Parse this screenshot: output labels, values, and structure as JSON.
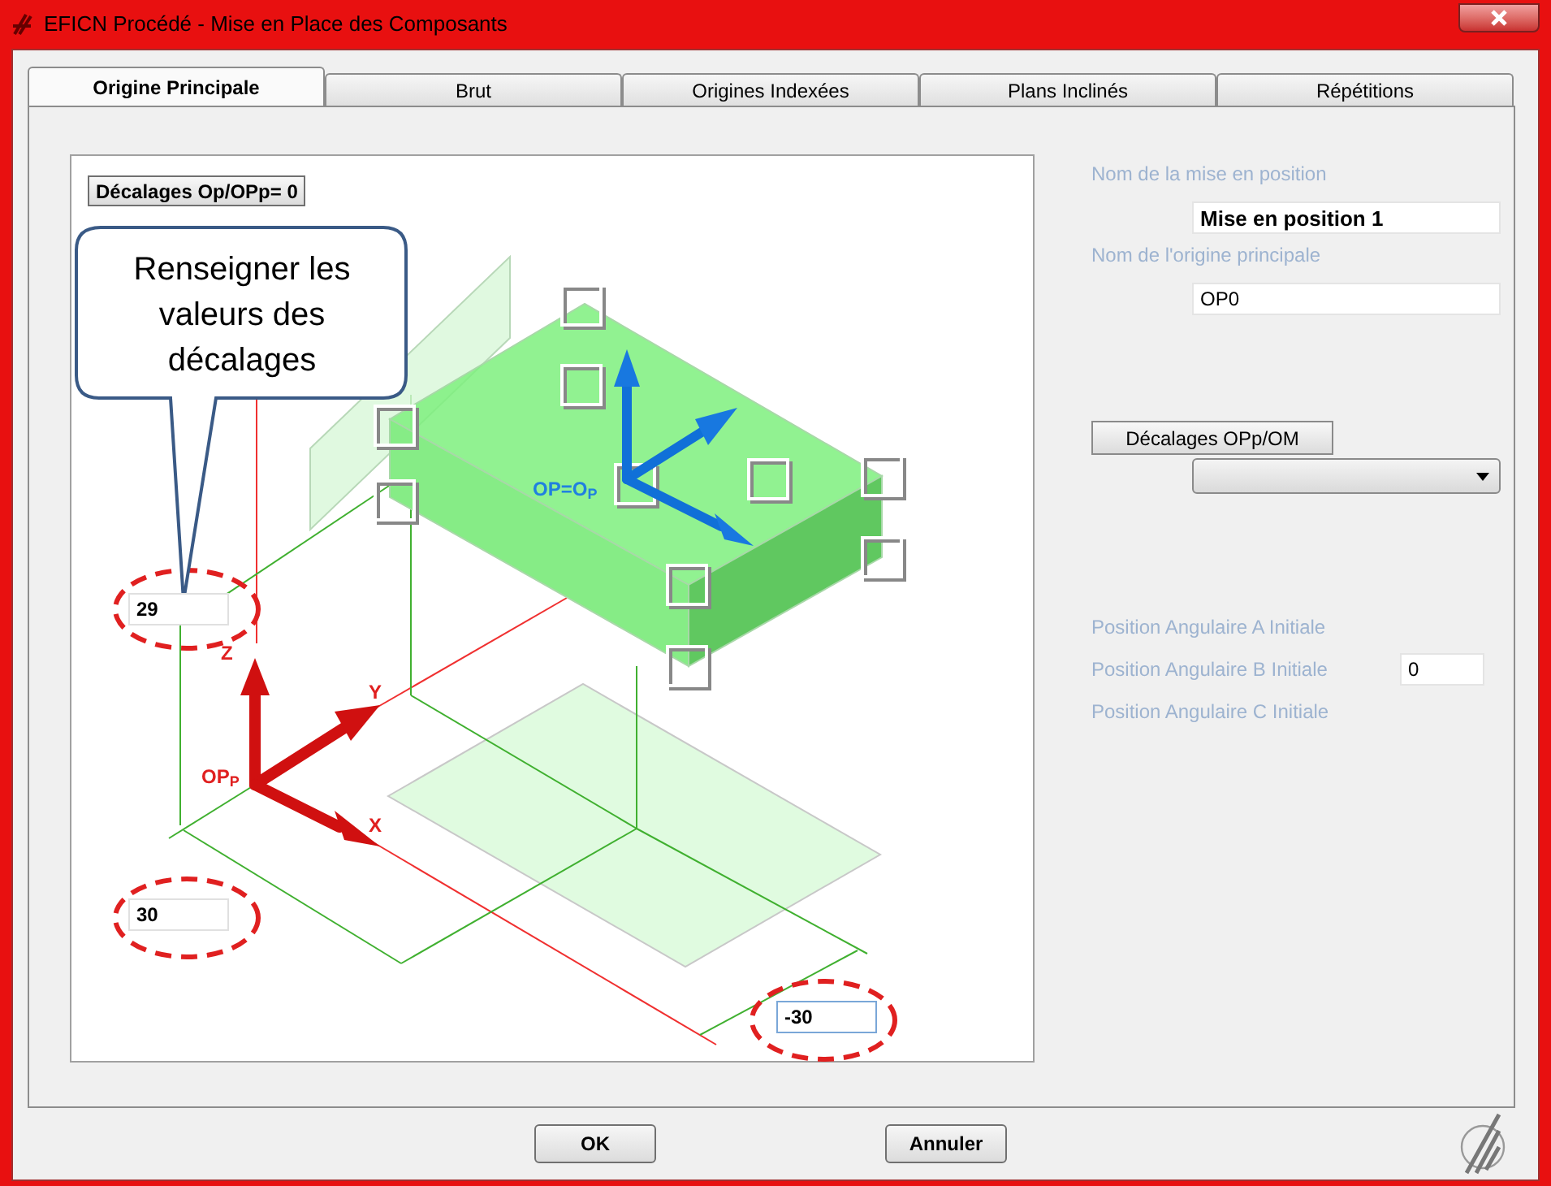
{
  "window": {
    "title": "EFICN Procédé - Mise en Place des Composants"
  },
  "tabs": [
    {
      "label": "Origine Principale",
      "selected": true
    },
    {
      "label": "Brut",
      "selected": false
    },
    {
      "label": "Origines Indexées",
      "selected": false
    },
    {
      "label": "Plans Inclinés",
      "selected": false
    },
    {
      "label": "Répétitions",
      "selected": false
    }
  ],
  "diagram": {
    "offset_button": "Décalages Op/OPp= 0",
    "callout": "Renseigner les valeurs des décalages",
    "part_label": "OP=O$_{P}$",
    "origin_label": "OP$_{P}$",
    "axis_labels": [
      "Z",
      "Y",
      "X"
    ],
    "offset_fields": [
      {
        "value": "29",
        "focused": false
      },
      {
        "value": "30",
        "focused": false
      },
      {
        "value": "-30",
        "focused": true
      }
    ]
  },
  "right_panel": {
    "setup_name_label": "Nom de la mise en position",
    "setup_name": "Mise en position 1",
    "origin_name_label": "Nom de l'origine principale",
    "origin_name": "OP0",
    "offsets_button": "Décalages OPp/OM",
    "angles": [
      {
        "label": "Position Angulaire A Initiale"
      },
      {
        "label": "Position Angulaire B Initiale",
        "value": "0"
      },
      {
        "label": "Position Angulaire C Initiale"
      }
    ]
  },
  "buttons": [
    "OK",
    "Annuler"
  ]
}
